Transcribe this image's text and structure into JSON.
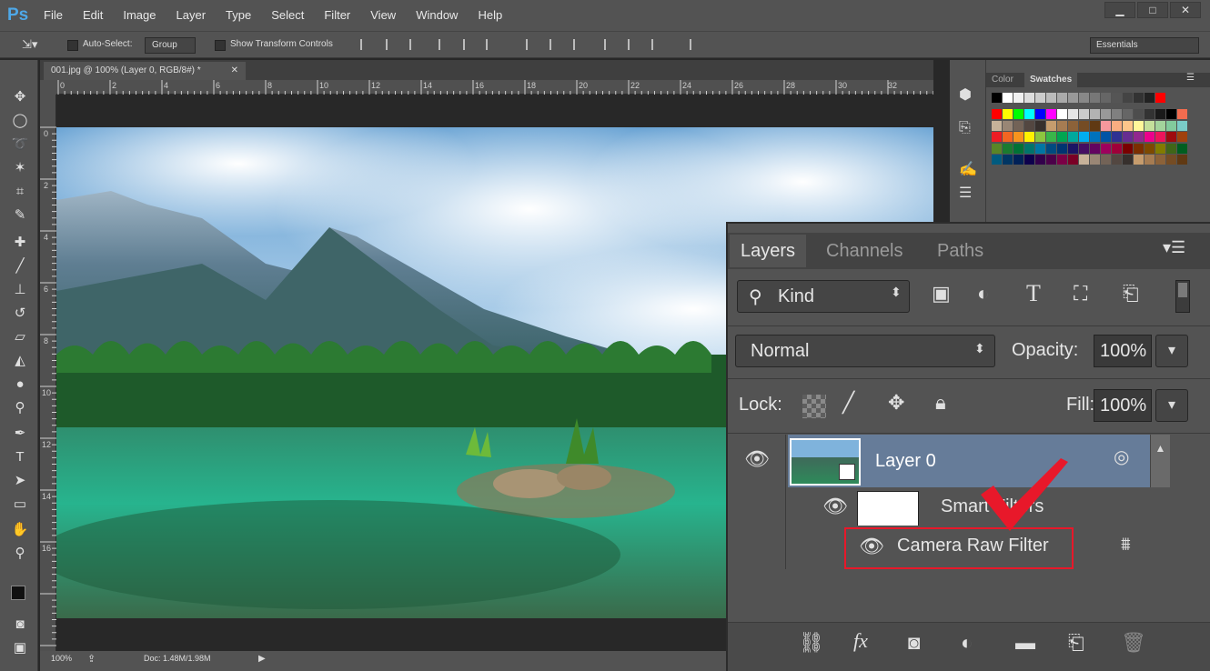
{
  "app": {
    "logo": "Ps"
  },
  "menu": [
    "File",
    "Edit",
    "Image",
    "Layer",
    "Type",
    "Select",
    "Filter",
    "View",
    "Window",
    "Help"
  ],
  "options": {
    "auto_select_label": "Auto-Select:",
    "auto_select_value": "Group",
    "show_transform_label": "Show Transform Controls",
    "workspace": "Essentials"
  },
  "document": {
    "tab_title": "001.jpg @ 100% (Layer 0, RGB/8#) *",
    "ruler_top": [
      "0",
      "2",
      "4",
      "6",
      "8",
      "10",
      "12",
      "14",
      "16",
      "18",
      "20",
      "22",
      "24",
      "26",
      "28",
      "30",
      "32"
    ],
    "ruler_left": [
      "0",
      "2",
      "4",
      "6",
      "8",
      "10",
      "12",
      "14",
      "16"
    ],
    "zoom": "100%",
    "doc_info": "Doc: 1.48M/1.98M"
  },
  "swatch_tabs": {
    "color": "Color",
    "swatches": "Swatches"
  },
  "layers_panel": {
    "tabs": [
      "Layers",
      "Channels",
      "Paths"
    ],
    "filter_kind": "Kind",
    "blend_mode": "Normal",
    "opacity_label": "Opacity:",
    "opacity_value": "100%",
    "lock_label": "Lock:",
    "fill_label": "Fill:",
    "fill_value": "100%",
    "layer_name": "Layer 0",
    "smart_filters_label": "Smart Filters",
    "filter_name": "Camera Raw Filter"
  },
  "colors": {
    "accent_red": "#e8182a",
    "selected_row": "#667c99"
  }
}
